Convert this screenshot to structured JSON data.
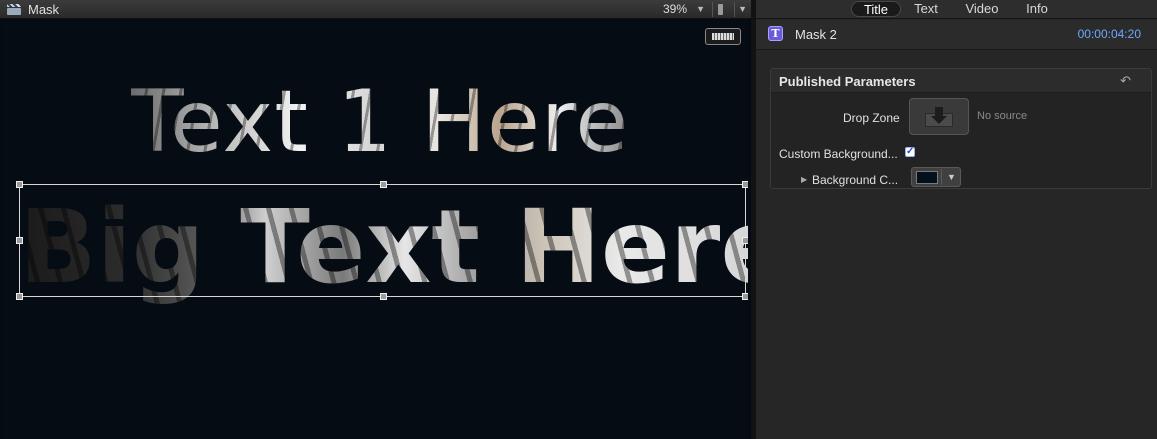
{
  "viewer": {
    "title": "Mask",
    "zoom": "39%",
    "zoom_caret": "▼",
    "view_caret": "▼",
    "canvas_text_1": "Text 1 Here",
    "canvas_text_2": "Big Text Here"
  },
  "inspector": {
    "tabs": [
      "Title",
      "Text",
      "Video",
      "Info"
    ],
    "active_tab": "Title",
    "item_icon_letter": "T",
    "item_name": "Mask 2",
    "item_timecode": "00:00:04:20",
    "section_title": "Published Parameters",
    "reset_glyph": "↶",
    "drop_zone_label": "Drop Zone",
    "drop_zone_value": "No source",
    "custom_bg_label": "Custom Background...",
    "custom_bg_checked": true,
    "check_glyph": "✓",
    "bg_color_label": "Background C...",
    "bg_color_hex": "#04101c",
    "disclosure_glyph": "▶",
    "color_caret": "▼"
  },
  "colors": {
    "canvas_bg": "#060c14",
    "timecode": "#6fa8ff",
    "item_icon": "#6b5bd6"
  }
}
